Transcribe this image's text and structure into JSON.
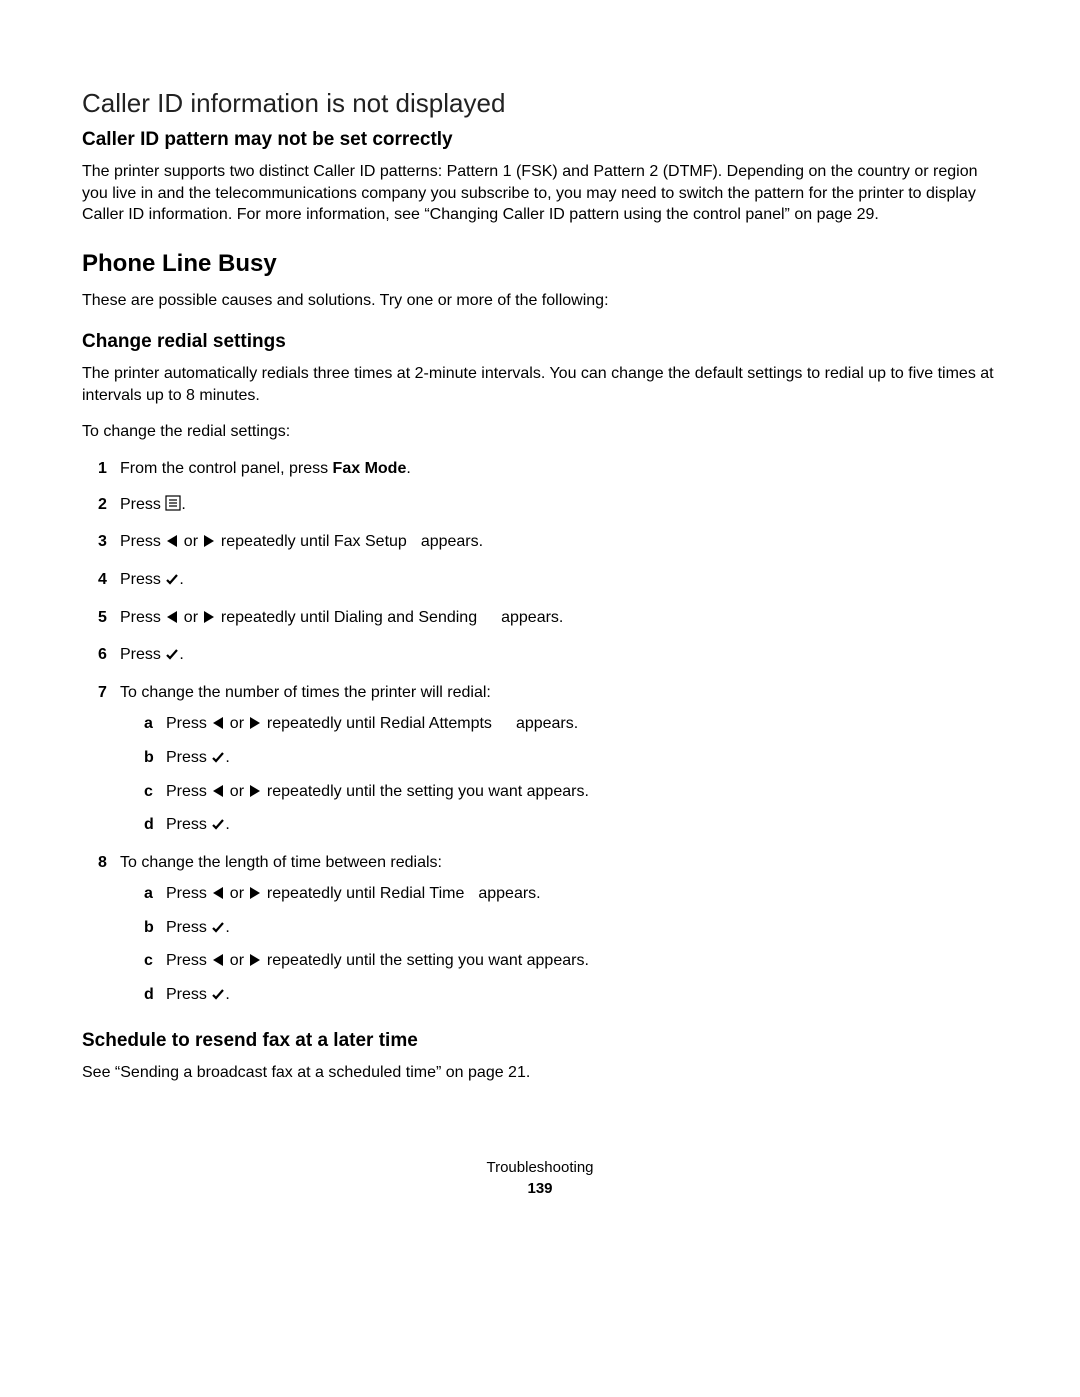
{
  "heading_caller_id": "Caller ID information is not displayed",
  "sub_caller_pattern": "Caller ID pattern may not be set correctly",
  "para_caller_pattern": "The printer supports two distinct Caller ID patterns: Pattern 1 (FSK) and Pattern 2 (DTMF). Depending on the country or region you live in and the telecommunications company you subscribe to, you may need to switch the pattern for the printer to display Caller ID information. For more information, see “Changing Caller ID pattern using the control panel” on page 29.",
  "heading_phone_busy": "Phone Line Busy",
  "para_causes": "These are possible causes and solutions. Try one or more of the following:",
  "sub_change_redial": "Change redial settings",
  "para_redial_desc": "The printer automatically redials three times at 2-minute intervals. You can change the default settings to redial up to five times at intervals up to 8 minutes.",
  "para_to_change": "To change the redial settings:",
  "steps": {
    "s1_a": "From the control panel, press ",
    "s1_b": "Fax Mode",
    "s1_c": ".",
    "s2_a": "Press ",
    "s2_b": ".",
    "s3_a": "Press ",
    "s3_b": " or ",
    "s3_c": " repeatedly until Fax Setup",
    "s3_d": "appears.",
    "s4_a": "Press ",
    "s4_b": ".",
    "s5_a": "Press ",
    "s5_b": " or ",
    "s5_c": " repeatedly until Dialing and Sending",
    "s5_d": "appears.",
    "s6_a": "Press ",
    "s6_b": ".",
    "s7": "To change the number of times the printer will redial:",
    "s7a_a": "Press ",
    "s7a_b": " or ",
    "s7a_c": " repeatedly until Redial Attempts",
    "s7a_d": "appears.",
    "s7b_a": "Press ",
    "s7b_b": ".",
    "s7c_a": "Press ",
    "s7c_b": " or ",
    "s7c_c": " repeatedly until the setting you want appears.",
    "s7d_a": "Press ",
    "s7d_b": ".",
    "s8": "To change the length of time between redials:",
    "s8a_a": "Press ",
    "s8a_b": " or ",
    "s8a_c": " repeatedly until Redial Time",
    "s8a_d": "appears.",
    "s8b_a": "Press ",
    "s8b_b": ".",
    "s8c_a": "Press ",
    "s8c_b": " or ",
    "s8c_c": " repeatedly until the setting you want appears.",
    "s8d_a": "Press ",
    "s8d_b": "."
  },
  "sub_schedule": "Schedule to resend fax at a later time",
  "para_schedule": "See “Sending a broadcast fax at a scheduled time” on page 21.",
  "footer_section": "Troubleshooting",
  "footer_page": "139"
}
